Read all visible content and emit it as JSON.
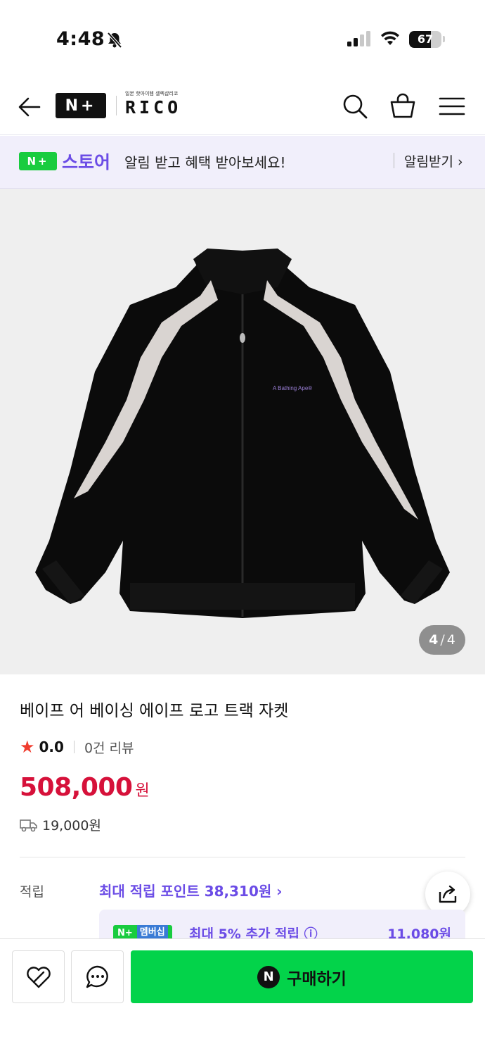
{
  "status_bar": {
    "time": "4:48",
    "battery": "67",
    "battery_level": 0.67
  },
  "header": {
    "brand_badge": "N+",
    "store_tagline": "일본 핫아이템 셀렉샵리코",
    "store_name": "RICO",
    "icons": [
      "back-arrow-icon",
      "search-icon",
      "cart-icon",
      "menu-icon"
    ]
  },
  "promo_banner": {
    "badge": "N+",
    "store_label": "스토어",
    "message": "알림 받고 혜택 받아보세요!",
    "action": "알림받기 ›"
  },
  "gallery": {
    "current": "4",
    "total": "4",
    "print_text": "A Bathing Ape®"
  },
  "product": {
    "title": "베이프 어 베이싱 에이프 로고 트랙 자켓",
    "rating": "0.0",
    "review_count": "0건 리뷰",
    "price": "508,000",
    "currency": "원",
    "shipping_fee": "19,000원"
  },
  "points": {
    "label": "적립",
    "max_points": "최대 적립 포인트 38,310원 ›",
    "membership_badge": "N+",
    "membership_label": "멤버십",
    "membership_text": "최대 5% 추가 적립 ⓘ",
    "membership_amount": "11,080원"
  },
  "bottom_bar": {
    "buy_icon": "N",
    "buy_label": "구매하기"
  },
  "colors": {
    "accent_purple": "#6b4ce6",
    "price_red": "#d6113a",
    "naver_green": "#03d34a",
    "promo_bg": "#f1effb"
  }
}
